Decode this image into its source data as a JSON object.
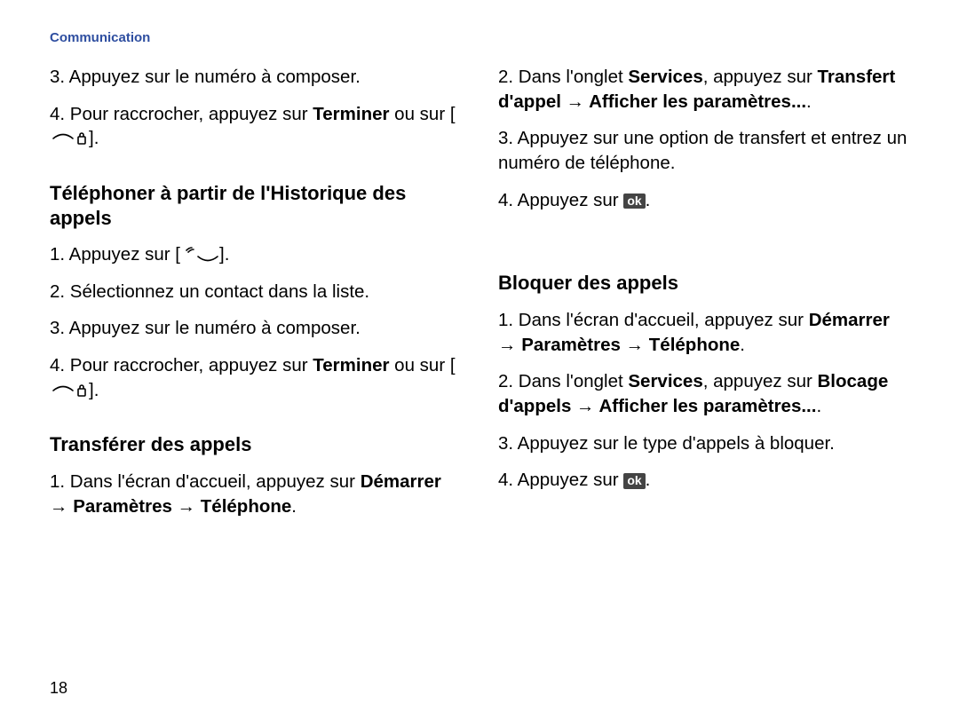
{
  "section": "Communication",
  "page_number": "18",
  "left": {
    "intro_steps": {
      "s3": "3. Appuyez sur le numéro à composer.",
      "s4_a": "4. Pour raccrocher, appuyez sur ",
      "s4_b": "Terminer",
      "s4_c": " ou sur ["
    },
    "h1": "Téléphoner à partir de l'Historique des appels",
    "hist_steps": {
      "s1": "1. Appuyez sur [",
      "s2": "2. Sélectionnez un contact dans la liste.",
      "s3": "3. Appuyez sur le numéro à composer.",
      "s4_a": "4. Pour raccrocher, appuyez sur ",
      "s4_b": "Terminer",
      "s4_c": " ou sur ["
    },
    "h2": "Transférer des appels",
    "trans_steps": {
      "s1_a": "1. Dans l'écran d'accueil, appuyez sur ",
      "s1_b": "Démarrer → Paramètres → Téléphone",
      "s1_c": "."
    }
  },
  "right": {
    "trans_cont": {
      "s2_a": "2. Dans l'onglet ",
      "s2_b": "Services",
      "s2_c": ", appuyez sur ",
      "s2_d": "Transfert d'appel → Afficher les paramètres...",
      "s2_e": ".",
      "s3": "3. Appuyez sur une option de transfert et entrez un numéro de téléphone.",
      "s4_a": "4. Appuyez sur ",
      "s4_b": "ok",
      "s4_c": "."
    },
    "h1": "Bloquer des appels",
    "block_steps": {
      "s1_a": "1. Dans l'écran d'accueil, appuyez sur ",
      "s1_b": "Démarrer → Paramètres → Téléphone",
      "s1_c": ".",
      "s2_a": "2. Dans l'onglet ",
      "s2_b": "Services",
      "s2_c": ", appuyez sur ",
      "s2_d": "Blocage d'appels → Afficher les paramètres...",
      "s2_e": ".",
      "s3": "3. Appuyez sur le type d'appels à bloquer.",
      "s4_a": "4. Appuyez sur ",
      "s4_b": "ok",
      "s4_c": "."
    }
  }
}
